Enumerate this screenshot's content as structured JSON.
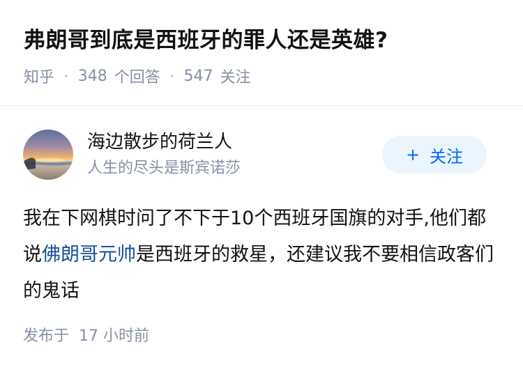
{
  "question": {
    "title": "弗朗哥到底是西班牙的罪人还是英雄?",
    "source": "知乎",
    "separator": "·",
    "answer_count": "348",
    "answer_label": "个回答",
    "follower_count": "547",
    "follower_label": "关注"
  },
  "answer": {
    "author": {
      "name": "海边散步的荷兰人",
      "bio": "人生的尽头是斯宾诺莎",
      "avatar_icon": "sunset-beach-avatar"
    },
    "follow_button": {
      "plus": "+",
      "label": "关注"
    },
    "content": {
      "part1": "我在下网棋时问了不下于10个西班牙国旗的对手,他们都说",
      "link": "佛朗哥元帅",
      "part2": "是西班牙的救星，还建议我不要相信政客们的鬼话"
    },
    "published_label": "发布于",
    "published_time": "17 小时前"
  },
  "colors": {
    "accent": "#0066ff",
    "link": "#175199",
    "meta_gray": "#8590a6",
    "follow_bg": "#ebf5fd"
  }
}
